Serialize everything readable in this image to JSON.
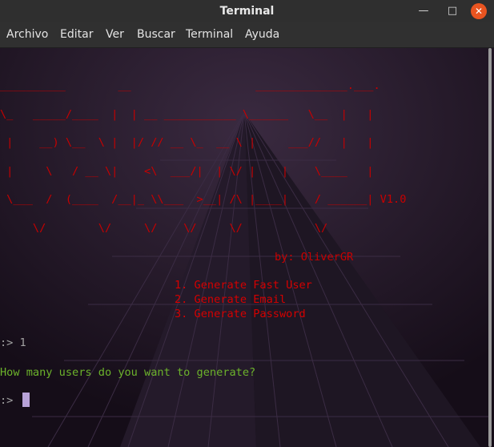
{
  "window": {
    "title": "Terminal"
  },
  "menu": [
    "Archivo",
    "Editar",
    "Ver",
    "Buscar",
    "Terminal",
    "Ayuda"
  ],
  "terminal": {
    "art_lines": [
      "__________        __                   ______________.___.",
      "\\_   _____/____  |  | __ ___________ \\______   \\__  |   |",
      " |    __) \\__  \\ |  |/ // __ \\_  __ \\ |     ___//   |   |",
      " |     \\   / __ \\|    <\\  ___/|  | \\/ |    |    \\____   |",
      " \\___  /  (____  /__|_ \\\\___  >__| /\\ |____|    / ______| V1.0",
      "     \\/        \\/     \\/    \\/     \\/           \\/"
    ],
    "author": "by: OliverGR",
    "options": [
      "1. Generate Fast User",
      "2. Generate Email",
      "3. Generate Password"
    ],
    "prompt1": ":> 1",
    "question": "How many users do you want to generate?",
    "prompt2": ":> "
  },
  "colors": {
    "art": "#c80000",
    "question": "#6cb32b",
    "prompt": "#a2a2a2",
    "background": "#1d1322",
    "close_button": "#e95420"
  }
}
